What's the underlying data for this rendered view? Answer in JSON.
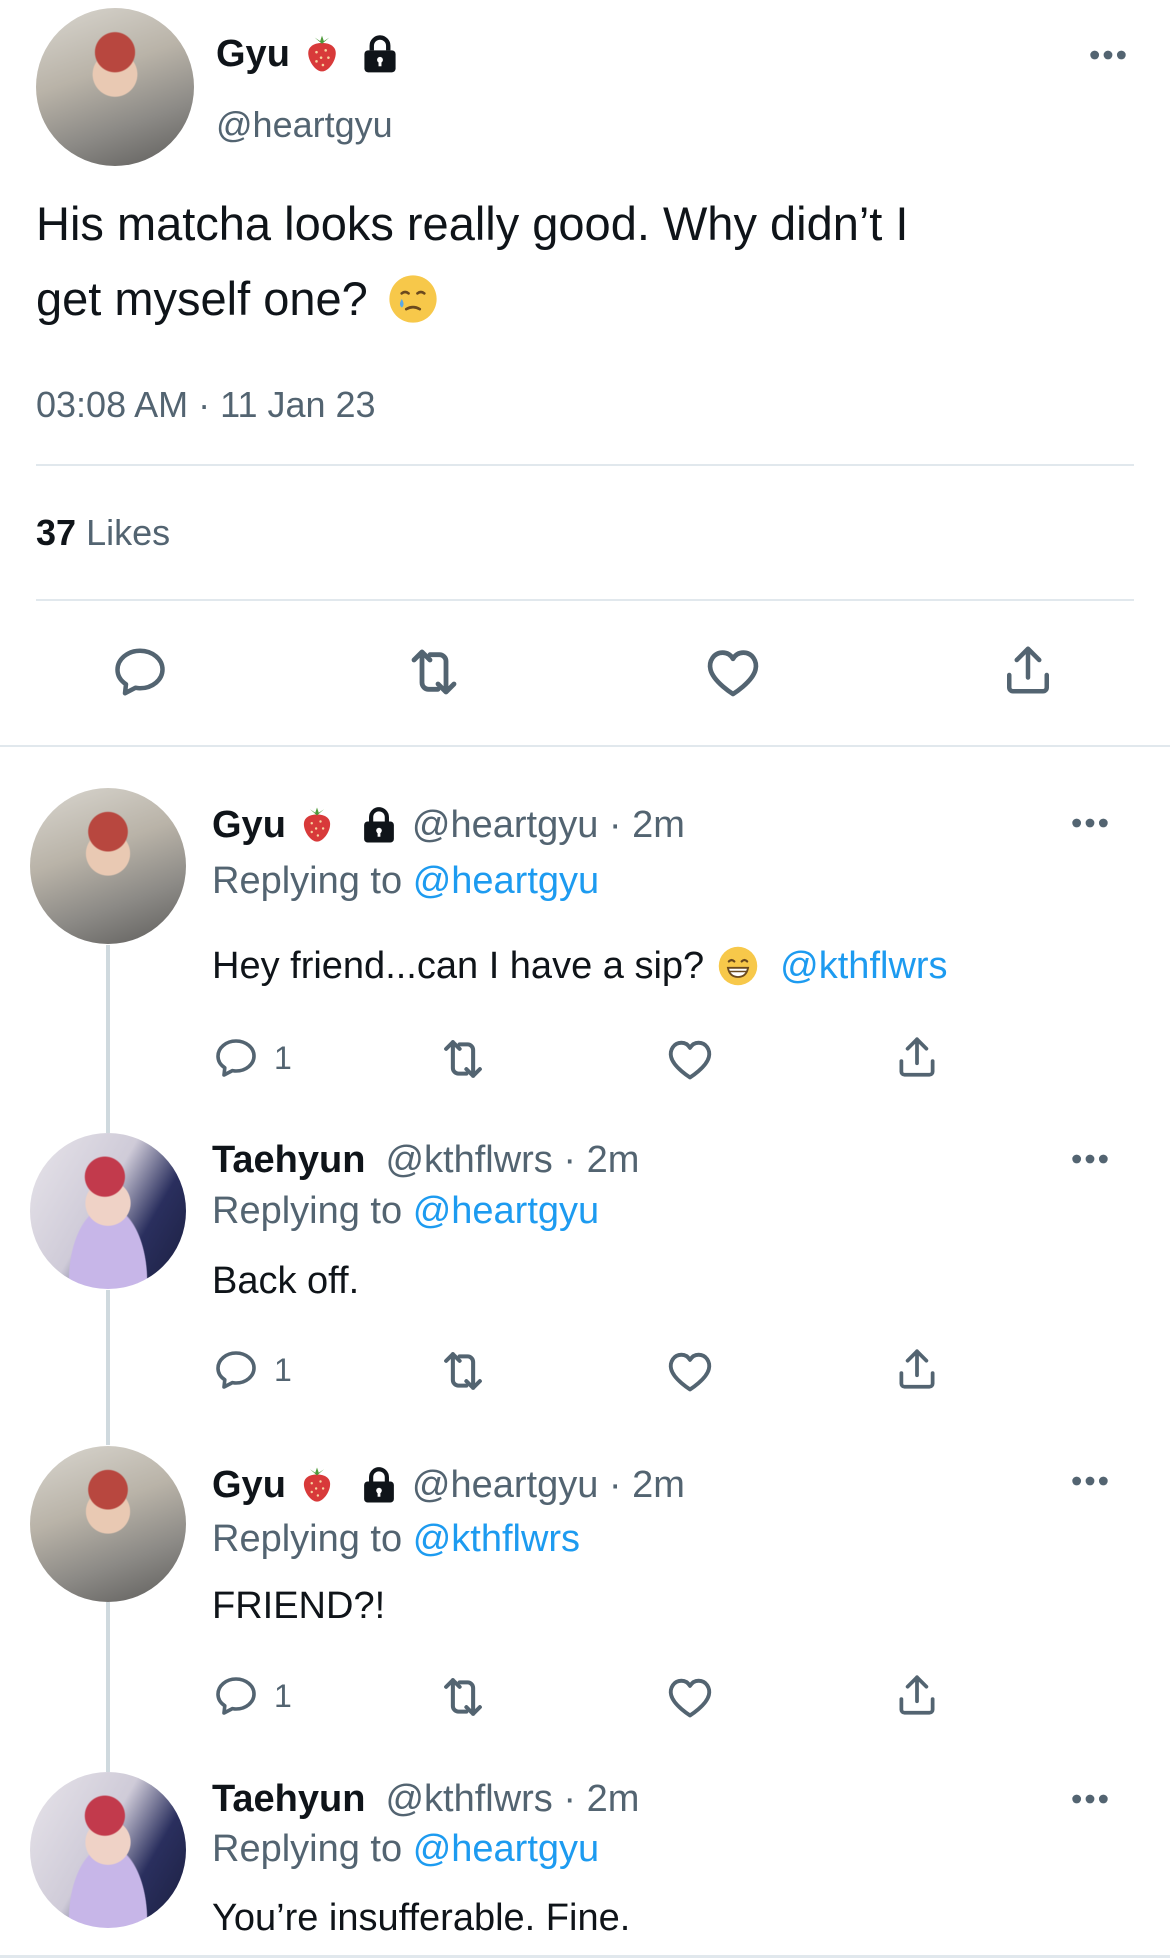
{
  "main": {
    "name": "Gyu",
    "handle": "@heartgyu",
    "text_line1": "His matcha looks really good. Why didn’t I",
    "text_line2": "get myself one?",
    "timestamp": "03:08 AM · 11 Jan 23",
    "likes_count": "37",
    "likes_label": "Likes"
  },
  "replies": [
    {
      "name": "Gyu",
      "handle_time": "@heartgyu · 2m",
      "replying_prefix": "Replying to",
      "replying_to": "@heartgyu",
      "text": "Hey friend...can I have a sip?",
      "mention": "@kthflwrs",
      "reply_count": "1"
    },
    {
      "name": "Taehyun",
      "handle_time": "@kthflwrs · 2m",
      "replying_prefix": "Replying to",
      "replying_to": "@heartgyu",
      "text": "Back off.",
      "reply_count": "1"
    },
    {
      "name": "Gyu",
      "handle_time": "@heartgyu · 2m",
      "replying_prefix": "Replying to",
      "replying_to": "@kthflwrs",
      "text": "FRIEND?!",
      "reply_count": "1"
    },
    {
      "name": "Taehyun",
      "handle_time": "@kthflwrs · 2m",
      "replying_prefix": "Replying to",
      "replying_to": "@heartgyu",
      "text": "You’re insufferable. Fine."
    }
  ],
  "colors": {
    "link": "#1d9bf0",
    "secondary": "#536471",
    "divider": "#e1e8ed"
  },
  "icons": [
    "strawberry-icon",
    "lock-icon",
    "more-icon",
    "reply-icon",
    "retweet-icon",
    "like-icon",
    "share-icon",
    "tear-emoji-icon",
    "grin-emoji-icon"
  ]
}
